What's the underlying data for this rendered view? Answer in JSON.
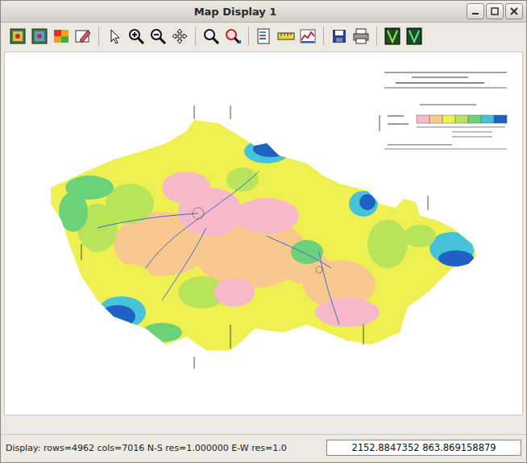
{
  "window": {
    "title": "Map Display 1"
  },
  "map": {
    "legend": [
      {
        "color": "#f7b9c9"
      },
      {
        "color": "#f8c88e"
      },
      {
        "color": "#eef052"
      },
      {
        "color": "#b7e45a"
      },
      {
        "color": "#6cd27a"
      },
      {
        "color": "#46c3d9"
      },
      {
        "color": "#1f62c4"
      }
    ]
  },
  "status_bar": {
    "text": "Display: rows=4962 cols=7016 N-S res=1.000000 E-W res=1.0",
    "coordinates": "2152.8847352 863.869158879"
  }
}
